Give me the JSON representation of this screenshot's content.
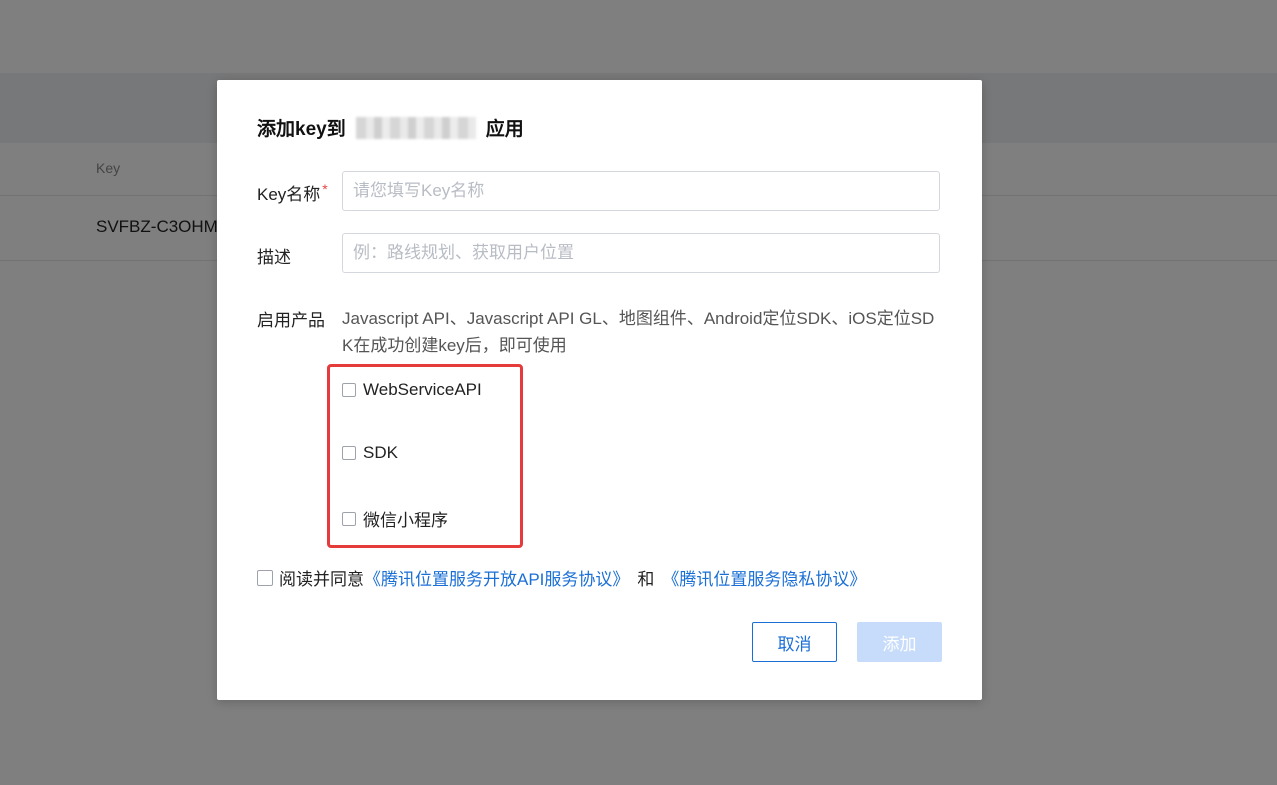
{
  "background": {
    "column_header": "Key",
    "row_key": "SVFBZ-C3OHM"
  },
  "dialog": {
    "title_prefix": "添加key到",
    "title_suffix": "应用",
    "key_name": {
      "label": "Key名称",
      "required_mark": "*",
      "placeholder": "请您填写Key名称",
      "value": ""
    },
    "description": {
      "label": "描述",
      "placeholder": "例：路线规划、获取用户位置",
      "value": ""
    },
    "products": {
      "label": "启用产品",
      "note": "Javascript API、Javascript API GL、地图组件、Android定位SDK、iOS定位SDK在成功创建key后，即可使用",
      "options": [
        {
          "label": "WebServiceAPI",
          "checked": false
        },
        {
          "label": "SDK",
          "checked": false
        },
        {
          "label": "微信小程序",
          "checked": false
        }
      ]
    },
    "agreement": {
      "prefix": "阅读并同意",
      "link1": "《腾讯位置服务开放API服务协议》",
      "and": "和",
      "link2": "《腾讯位置服务隐私协议》",
      "checked": false
    },
    "buttons": {
      "cancel": "取消",
      "add": "添加"
    }
  },
  "colors": {
    "primary": "#1a6fd6",
    "disabled_button": "#c7dcfb",
    "highlight_box": "#e63b3b",
    "required": "#e54545"
  }
}
